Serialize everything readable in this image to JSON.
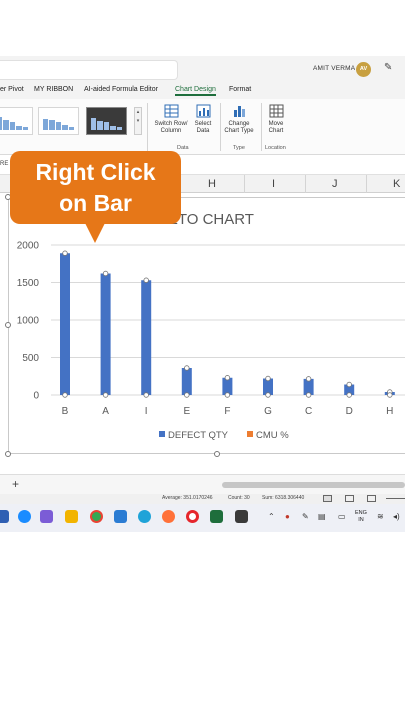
{
  "titlebar": {
    "user_name": "AMIT VERMA",
    "avatar_initials": "AV"
  },
  "tabs": [
    {
      "label": "er Pivot",
      "active": false
    },
    {
      "label": "MY RIBBON",
      "active": false
    },
    {
      "label": "AI-aided Formula Editor",
      "active": false
    },
    {
      "label": "Chart Design",
      "active": true
    },
    {
      "label": "Format",
      "active": false
    }
  ],
  "ribbon": {
    "switch_row_column": "Switch Row/ Column",
    "select_data": "Select Data",
    "data_group": "Data",
    "change_chart_type": "Change Chart Type",
    "type_group": "Type",
    "move_chart": "Move Chart",
    "location_group": "Location"
  },
  "formula_bar": {
    "name_box_partial": "RE"
  },
  "columns": [
    "H",
    "I",
    "J",
    "K"
  ],
  "callout": {
    "line1": "Right Click",
    "line2": "on Bar"
  },
  "chart_data": {
    "type": "bar",
    "title": "PARETO CHART",
    "visible_title": "RETO CHART",
    "categories": [
      "B",
      "A",
      "I",
      "E",
      "F",
      "G",
      "C",
      "D",
      "H"
    ],
    "series": [
      {
        "name": "DEFECT QTY",
        "values": [
          1890,
          1620,
          1530,
          360,
          230,
          220,
          215,
          140,
          40
        ],
        "color": "#4472c4"
      },
      {
        "name": "CMU %",
        "values": [],
        "color": "#ed7d31"
      }
    ],
    "yticks": [
      "0",
      "500",
      "1000",
      "1500",
      "2000"
    ],
    "ylim": [
      0,
      2000
    ],
    "grid": true,
    "legend": "bottom"
  },
  "status": {
    "average": "Average: 351.0170246",
    "count": "Count: 30",
    "sum": "Sum: 6318.306440"
  },
  "taskbar": {
    "lang_line1": "ENG",
    "lang_line2": "IN"
  },
  "colors": {
    "accent": "#1e6e3c",
    "callout": "#e67718",
    "bar": "#4472c4"
  }
}
